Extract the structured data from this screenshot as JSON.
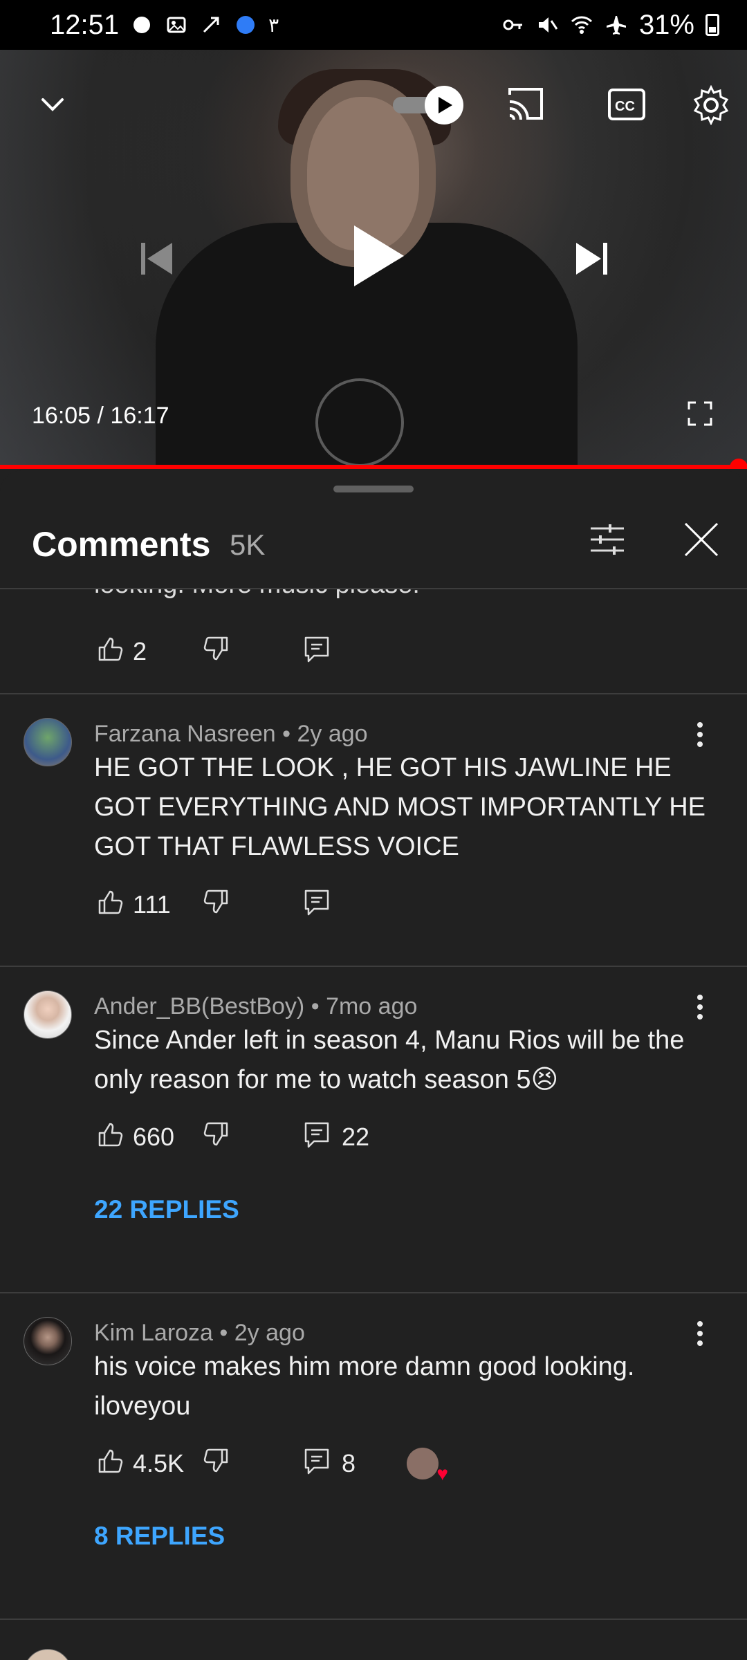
{
  "status_bar": {
    "time": "12:51",
    "extra_char": "٣",
    "battery": "31%"
  },
  "video": {
    "time_display": "16:05 / 16:17",
    "progress": 0.989,
    "icons": {
      "collapse": "chevron-down-icon",
      "autoplay": "autoplay-toggle",
      "cast": "cast-icon",
      "captions": "closed-captions-icon",
      "settings": "gear-icon",
      "prev": "skip-previous-icon",
      "play": "play-icon",
      "next": "skip-next-icon",
      "fullscreen": "fullscreen-icon"
    }
  },
  "comments_panel": {
    "title": "Comments",
    "count": "5K",
    "cut_text": "looking. More music please!",
    "comments": [
      {
        "likes": "2",
        "has_reply_count": false
      },
      {
        "author": "Farzana Nasreen",
        "age": "2y ago",
        "text": "HE GOT THE LOOK , HE GOT HIS JAWLINE HE GOT EVERYTHING AND MOST IMPORTANTLY HE GOT THAT FLAWLESS VOICE",
        "likes": "111"
      },
      {
        "author": "Ander_BB(BestBoy)",
        "age": "7mo ago",
        "text": "Since Ander left in season 4, Manu Rios will be the only reason for me to watch season 5😣",
        "likes": "660",
        "reply_count": "22",
        "replies_link": "22 REPLIES"
      },
      {
        "author": "Kim Laroza",
        "age": "2y ago",
        "text": "his voice makes him more damn good looking. iloveyou",
        "likes": "4.5K",
        "reply_count": "8",
        "replies_link": "8 REPLIES"
      }
    ]
  },
  "colors": {
    "background": "#212121",
    "accent_blue": "#3ea6ff",
    "progress_red": "#ff0000"
  }
}
